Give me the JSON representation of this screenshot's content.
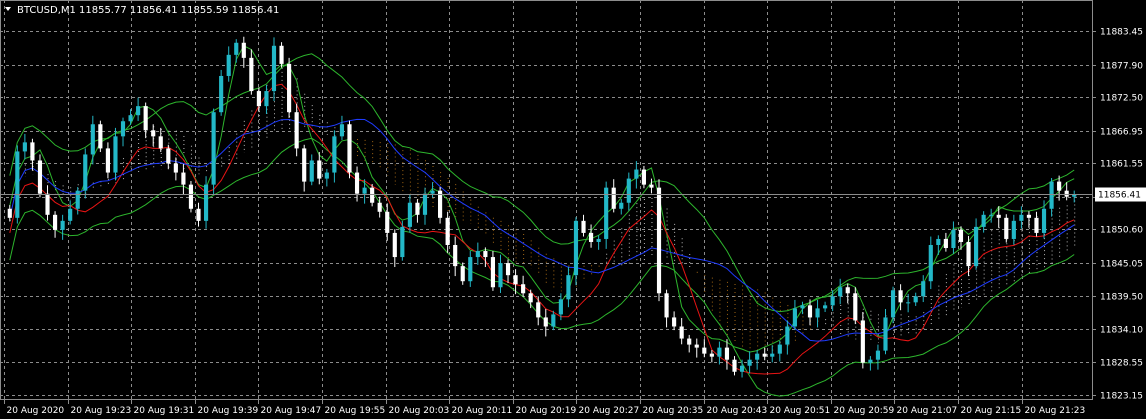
{
  "header": {
    "symbol_label": "BTCUSD,M1",
    "ohlc_text": "11855.77 11856.41 11855.59 11856.41"
  },
  "colors": {
    "background": "#000000",
    "grid": "#8c8c8c",
    "frame": "#8c8c8c",
    "bull_candle": "#23b8c8",
    "bear_candle": "#ffffff",
    "ma_red": "#e81414",
    "ma_blue": "#1f3cff",
    "envelope_green": "#2db52d",
    "ichimoku_cloud_light": "#f5f5f5",
    "ichimoku_cloud_orange": "#d8891b",
    "price_line": "#8c8c8c",
    "current_price_bg": "#ffffff",
    "current_price_fg": "#000000"
  },
  "chart_data": {
    "type": "candlestick",
    "symbol": "BTCUSD",
    "timeframe": "M1",
    "current_price": 11856.41,
    "current_price_label": "11856.41",
    "ylim": [
      11823.15,
      11886.6
    ],
    "y_ticks": [
      "11883.45",
      "11877.90",
      "11872.50",
      "11866.95",
      "11861.55",
      "11856.00",
      "11850.60",
      "11845.05",
      "11839.50",
      "11834.10",
      "11828.55",
      "11823.15"
    ],
    "y_tick_values": [
      11883.45,
      11877.9,
      11872.5,
      11866.95,
      11861.55,
      11856.0,
      11850.6,
      11845.05,
      11839.5,
      11834.1,
      11828.55,
      11823.15
    ],
    "x_ticks": [
      "20 Aug 2020",
      "20 Aug 19:23",
      "20 Aug 19:31",
      "20 Aug 19:39",
      "20 Aug 19:47",
      "20 Aug 19:55",
      "20 Aug 20:03",
      "20 Aug 20:11",
      "20 Aug 20:19",
      "20 Aug 20:27",
      "20 Aug 20:35",
      "20 Aug 20:43",
      "20 Aug 20:51",
      "20 Aug 20:59",
      "20 Aug 21:07",
      "20 Aug 21:15",
      "20 Aug 21:23"
    ],
    "grid": true,
    "candles_close": [
      11852.5,
      11863.5,
      11865.0,
      11862.0,
      11856.5,
      11853.0,
      11850.5,
      11852.0,
      11854.0,
      11857.0,
      11863.0,
      11868.0,
      11864.0,
      11860.0,
      11866.0,
      11868.5,
      11869.5,
      11871.0,
      11867.0,
      11866.0,
      11864.0,
      11861.5,
      11860.0,
      11858.0,
      11854.0,
      11852.0,
      11858.0,
      11870.0,
      11876.0,
      11879.5,
      11881.5,
      11879.0,
      11873.5,
      11871.0,
      11873.5,
      11881.0,
      11878.0,
      11870.0,
      11864.0,
      11858.5,
      11862.0,
      11859.0,
      11860.0,
      11866.0,
      11868.0,
      11860.0,
      11856.5,
      11857.5,
      11855.0,
      11853.5,
      11850.0,
      11846.0,
      11851.0,
      11855.0,
      11853.0,
      11856.5,
      11857.0,
      11852.5,
      11848.0,
      11844.5,
      11842.0,
      11846.0,
      11847.0,
      11846.0,
      11841.0,
      11845.0,
      11843.0,
      11841.5,
      11840.0,
      11838.5,
      11836.0,
      11834.5,
      11836.5,
      11839.0,
      11843.0,
      11852.0,
      11850.0,
      11848.5,
      11849.0,
      11857.5,
      11854.0,
      11855.0,
      11859.0,
      11860.5,
      11858.0,
      11857.5,
      11840.0,
      11836.0,
      11834.5,
      11832.5,
      11831.5,
      11831.0,
      11830.0,
      11829.5,
      11831.0,
      11829.0,
      11827.0,
      11828.0,
      11829.0,
      11830.0,
      11829.5,
      11830.0,
      11831.5,
      11834.5,
      11837.5,
      11838.0,
      11836.0,
      11837.5,
      11838.0,
      11839.5,
      11841.0,
      11840.0,
      11835.5,
      11828.5,
      11829.0,
      11830.5,
      11836.0,
      11840.5,
      11838.5,
      11838.5,
      11839.5,
      11842.0,
      11848.0,
      11849.0,
      11847.5,
      11850.5,
      11848.5,
      11844.5,
      11851.0,
      11853.0,
      11853.0,
      11852.5,
      11849.0,
      11852.0,
      11853.0,
      11852.5,
      11850.0,
      11854.0,
      11858.5,
      11857.0,
      11856.0,
      11856.41
    ]
  },
  "indicators": [
    "Moving Average (red)",
    "Moving Average (blue)",
    "Envelopes (green)",
    "Ichimoku Kinko Hyo"
  ]
}
